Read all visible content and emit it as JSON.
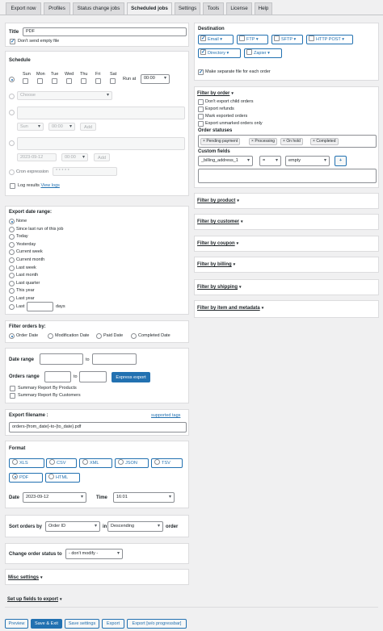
{
  "tabs": [
    "Export now",
    "Profiles",
    "Status change jobs",
    "Scheduled jobs",
    "Settings",
    "Tools",
    "License",
    "Help"
  ],
  "title_section": {
    "label": "Title",
    "value": "PDF",
    "dont_send_empty": "Don't send empty file"
  },
  "schedule": {
    "label": "Schedule",
    "days": [
      "Sun",
      "Mon",
      "Tue",
      "Wed",
      "Thu",
      "Fri",
      "Sat"
    ],
    "run_at_label": "Run at",
    "run_at_value": "00:00",
    "choose": "Choose",
    "sun": "Sun",
    "time": "00:00",
    "add": "Add",
    "date": "2023-09-12",
    "cron_label": "Cron expression",
    "cron_value": "* * * * *",
    "log_label": "Log results",
    "view_logs": "View logs"
  },
  "export_date_range": {
    "label": "Export date range:",
    "options": [
      "None",
      "Since last run of this job",
      "Today",
      "Yesterday",
      "Current week",
      "Current month",
      "Last week",
      "Last month",
      "Last quarter",
      "This year",
      "Last year",
      "Last"
    ],
    "days": "days"
  },
  "filter_orders_by": {
    "label": "Filter orders by:",
    "options": [
      "Order Date",
      "Modification Date",
      "Paid Date",
      "Completed Date"
    ]
  },
  "ranges": {
    "date_range": "Date range",
    "to": "to",
    "orders_range": "Orders range",
    "express_export": "Express export",
    "summary_products": "Summary Report By Products",
    "summary_customers": "Summary Report By Customers"
  },
  "filename": {
    "label": "Export filename :",
    "supported_tags": "supported tags",
    "value": "orders-{from_date}-to-{to_date}.pdf"
  },
  "format": {
    "label": "Format",
    "options": [
      "XLS",
      "CSV",
      "XML",
      "JSON",
      "TSV",
      "PDF",
      "HTML"
    ],
    "date_label": "Date",
    "date_value": "2023-09-12",
    "time_label": "Time",
    "time_value": "16:01"
  },
  "sort": {
    "label": "Sort orders by",
    "field": "Order ID",
    "in": "in",
    "direction": "Descending",
    "order": "order"
  },
  "change_status": {
    "label": "Change order status to",
    "value": "- don't modify -"
  },
  "misc": "Misc settings",
  "setup_fields": "Set up fields to export",
  "footer": {
    "preview": "Preview",
    "save_exit": "Save & Exit",
    "save_settings": "Save settings",
    "export": "Export",
    "export_wo": "Export [w/o progressbar]"
  },
  "destination": {
    "label": "Destination",
    "options": [
      "Email",
      "FTP",
      "SFTP",
      "HTTP POST",
      "Directory",
      "Zapier"
    ],
    "separate_file": "Make separate file for each order"
  },
  "filter_by_order": {
    "label": "Filter by order",
    "options": [
      "Don't export child orders",
      "Export refunds",
      "Mark exported orders",
      "Export unmarked orders only"
    ],
    "statuses_label": "Order statuses",
    "statuses": [
      "Pending payment",
      "Processing",
      "On hold",
      "Completed"
    ],
    "custom_fields_label": "Custom fields",
    "cf_field": "_billing_address_1",
    "cf_op": "=",
    "cf_value": "empty",
    "plus": "+"
  },
  "filters": [
    "Filter by product",
    "Filter by customer",
    "Filter by coupon",
    "Filter by billing",
    "Filter by shipping",
    "Filter by item and metadata"
  ],
  "colors": {
    "accent": "#2271b1",
    "border": "#dcdcde",
    "bg": "#f0f0f1"
  }
}
